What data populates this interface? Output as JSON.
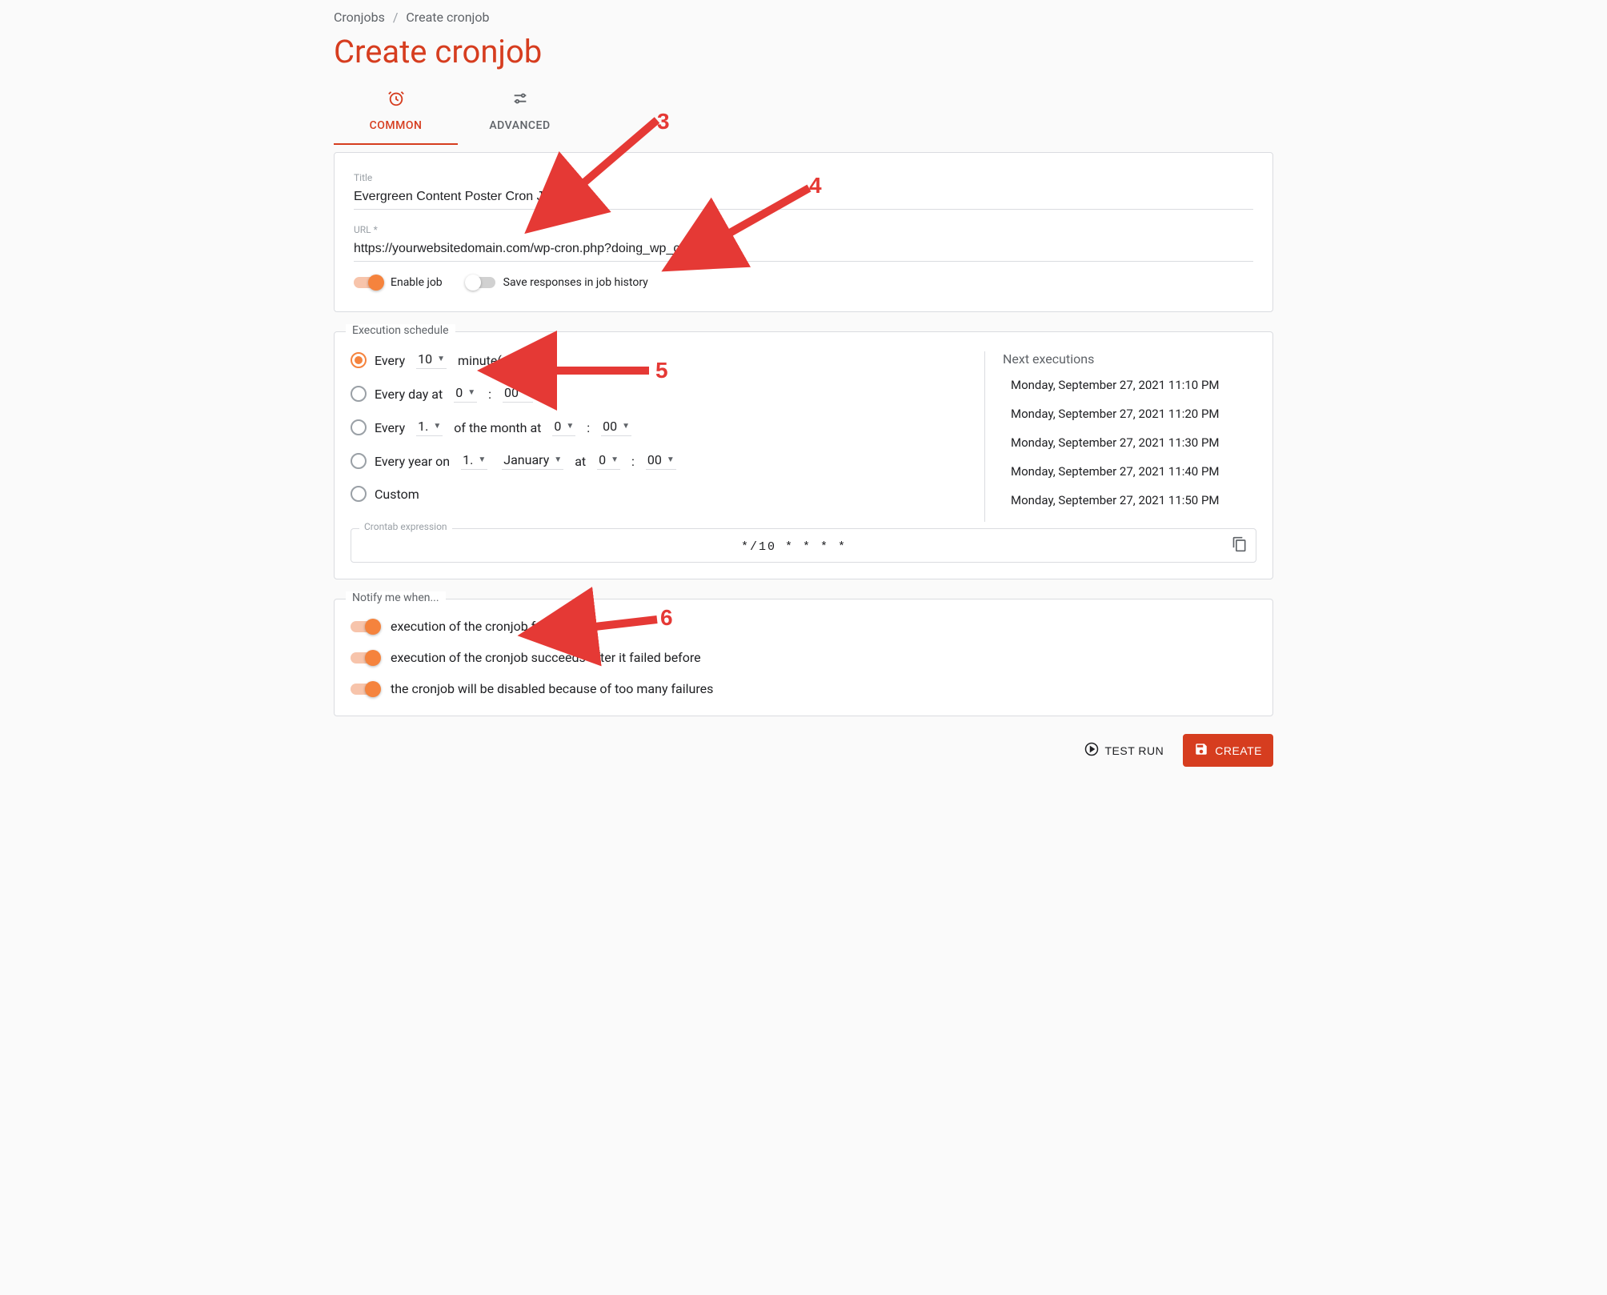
{
  "breadcrumb": {
    "root": "Cronjobs",
    "current": "Create cronjob"
  },
  "page_title": "Create cronjob",
  "tabs": {
    "common": "COMMON",
    "advanced": "ADVANCED"
  },
  "fields": {
    "title_label": "Title",
    "title_value": "Evergreen Content Poster Cron Job",
    "url_label": "URL *",
    "url_value": "https://yourwebsitedomain.com/wp-cron.php?doing_wp_cron"
  },
  "toggles": {
    "enable_job": "Enable job",
    "save_responses": "Save responses in job history"
  },
  "schedule": {
    "legend": "Execution schedule",
    "every": {
      "prefix": "Every",
      "value": "10",
      "unit": "minute(s)"
    },
    "daily": {
      "prefix": "Every day at",
      "hour": "0",
      "minute": "00"
    },
    "monthly": {
      "prefix_a": "Every",
      "day": "1.",
      "of": "of the month at",
      "hour": "0",
      "minute": "00"
    },
    "yearly": {
      "prefix": "Every year on",
      "day": "1.",
      "month": "January",
      "at": "at",
      "hour": "0",
      "minute": "00"
    },
    "custom": "Custom",
    "next_title": "Next executions",
    "next": [
      "Monday, September 27, 2021 11:10 PM",
      "Monday, September 27, 2021 11:20 PM",
      "Monday, September 27, 2021 11:30 PM",
      "Monday, September 27, 2021 11:40 PM",
      "Monday, September 27, 2021 11:50 PM"
    ],
    "crontab_label": "Crontab expression",
    "crontab_value": "*/10 * * * *"
  },
  "notify": {
    "legend": "Notify me when...",
    "fail": "execution of the cronjob fails",
    "recover": "execution of the cronjob succeeds after it failed before",
    "disable": "the cronjob will be disabled because of too many failures"
  },
  "footer": {
    "test_run": "TEST RUN",
    "create": "CREATE"
  },
  "annotations": {
    "n3": "3",
    "n4": "4",
    "n5": "5",
    "n6": "6"
  }
}
